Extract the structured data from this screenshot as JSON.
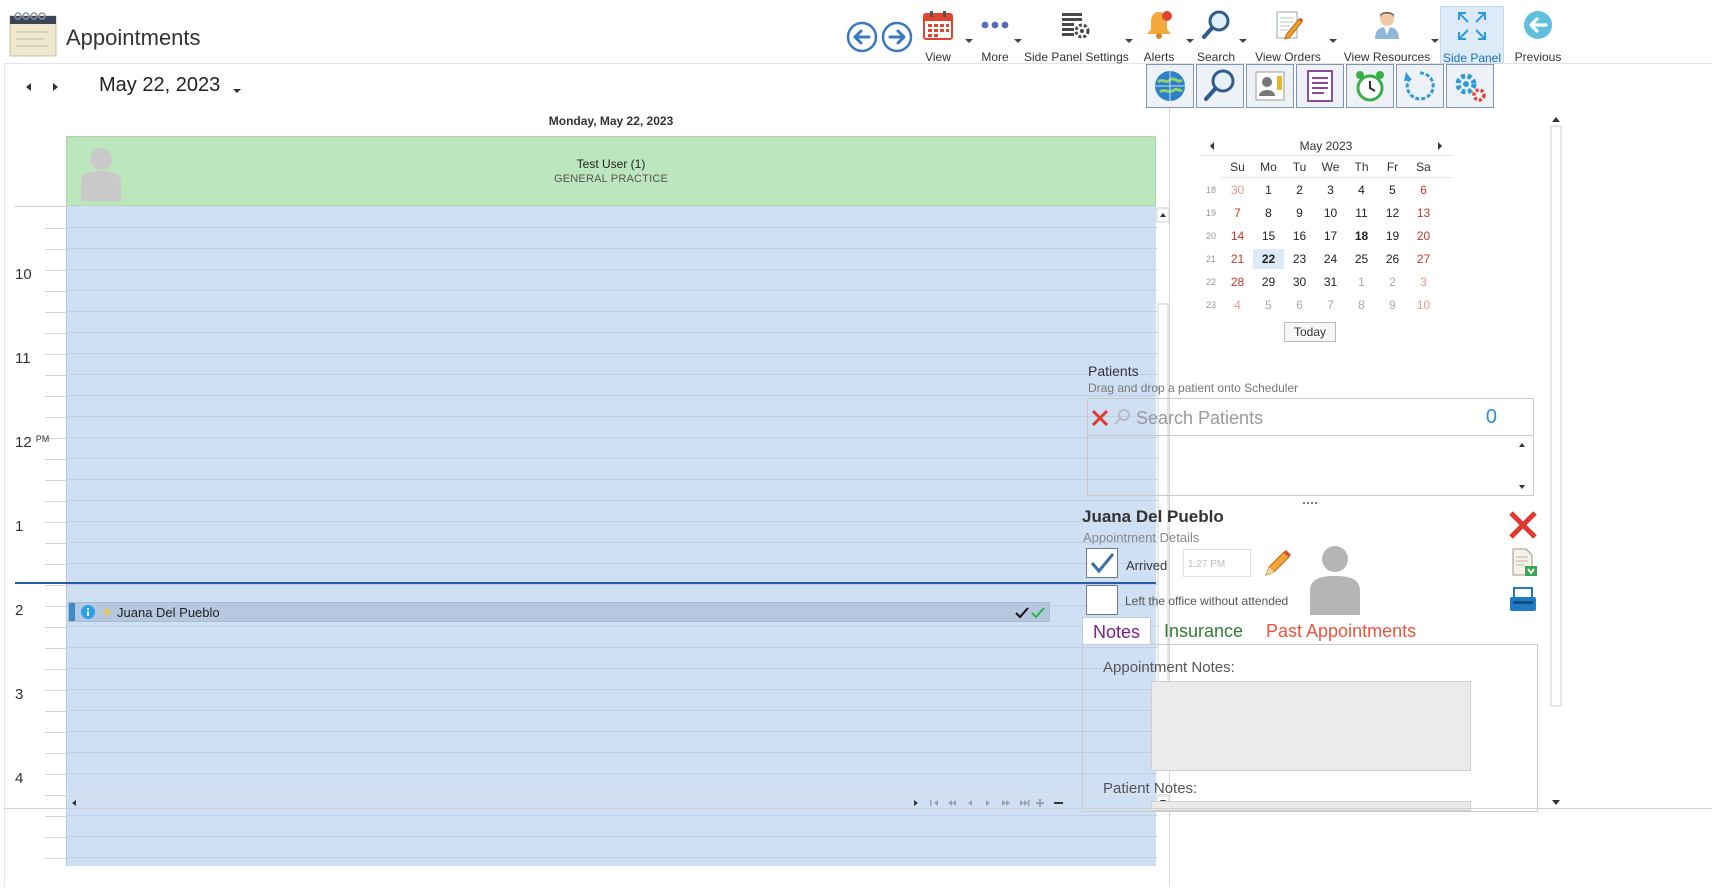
{
  "app": {
    "title": "Appointments"
  },
  "toolbar": {
    "back_label": "",
    "forward_label": "",
    "buttons": [
      {
        "id": "view",
        "label": "View",
        "icon": "calendar-icon"
      },
      {
        "id": "more",
        "label": "More",
        "icon": "more-dots-icon"
      },
      {
        "id": "side_panel_settings",
        "label": "Side Panel Settings",
        "icon": "table-settings-icon"
      },
      {
        "id": "alerts",
        "label": "Alerts",
        "icon": "bell-icon"
      },
      {
        "id": "search",
        "label": "Search",
        "icon": "search-icon"
      },
      {
        "id": "view_orders",
        "label": "View Orders",
        "icon": "orders-icon"
      },
      {
        "id": "view_resources",
        "label": "View Resources",
        "icon": "resources-icon"
      },
      {
        "id": "side_panel",
        "label": "Side Panel",
        "icon": "expand-icon",
        "active": true
      },
      {
        "id": "previous",
        "label": "Previous",
        "icon": "back-circle-icon"
      }
    ]
  },
  "scheduler": {
    "date": "May 22, 2023",
    "day_header": "Monday, May 22, 2023",
    "resource": {
      "name": "Test User (1)",
      "department": "GENERAL PRACTICE"
    },
    "hours": [
      {
        "label": "10",
        "suffix": ""
      },
      {
        "label": "11",
        "suffix": ""
      },
      {
        "label": "12",
        "suffix": "PM"
      },
      {
        "label": "1",
        "suffix": ""
      },
      {
        "label": "2",
        "suffix": ""
      },
      {
        "label": "3",
        "suffix": ""
      },
      {
        "label": "4",
        "suffix": ""
      }
    ],
    "appointment": {
      "patient": "Juana Del Pueblo"
    }
  },
  "side_panel": {
    "mini_calendar": {
      "month_label": "May 2023",
      "weekdays": [
        "Su",
        "Mo",
        "Tu",
        "We",
        "Th",
        "Fr",
        "Sa"
      ],
      "weeks": [
        {
          "wk": "18",
          "days": [
            "30",
            "1",
            "2",
            "3",
            "4",
            "5",
            "6"
          ]
        },
        {
          "wk": "19",
          "days": [
            "7",
            "8",
            "9",
            "10",
            "11",
            "12",
            "13"
          ]
        },
        {
          "wk": "20",
          "days": [
            "14",
            "15",
            "16",
            "17",
            "18",
            "19",
            "20"
          ]
        },
        {
          "wk": "21",
          "days": [
            "21",
            "22",
            "23",
            "24",
            "25",
            "26",
            "27"
          ]
        },
        {
          "wk": "22",
          "days": [
            "28",
            "29",
            "30",
            "31",
            "1",
            "2",
            "3"
          ]
        },
        {
          "wk": "23",
          "days": [
            "4",
            "5",
            "6",
            "7",
            "8",
            "9",
            "10"
          ]
        }
      ],
      "selected_day": "22",
      "today_day": "18",
      "today_button": "Today"
    },
    "patients": {
      "title": "Patients",
      "subtitle": "Drag and drop a patient onto Scheduler",
      "search_placeholder": "Search Patients",
      "count": "0"
    },
    "details": {
      "patient_name": "Juana Del Pueblo",
      "subtitle": "Appointment Details",
      "arrived_label": "Arrived",
      "arrived_checked": true,
      "arrived_time": "1:27 PM",
      "left_label": "Left the office without attended",
      "left_checked": false
    },
    "tabs": [
      {
        "label": "Notes",
        "color": "#7b1f86",
        "active": true
      },
      {
        "label": "Insurance",
        "color": "#2e7d32",
        "active": false
      },
      {
        "label": "Past Appointments",
        "color": "#e8553f",
        "active": false
      }
    ],
    "notes": {
      "appointment_label": "Appointment Notes:",
      "patient_label": "Patient Notes:"
    }
  }
}
